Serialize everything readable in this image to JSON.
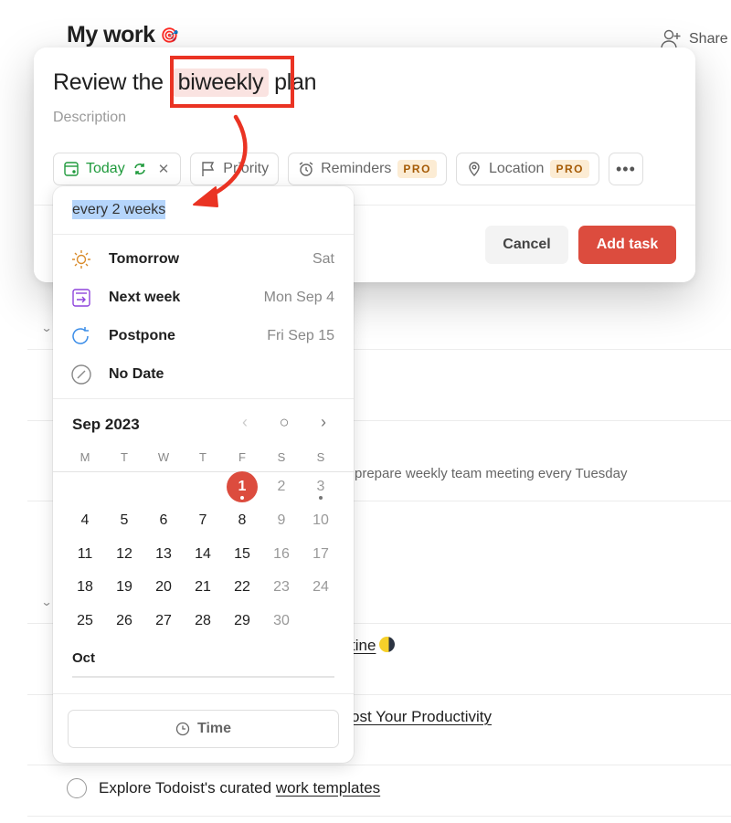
{
  "page": {
    "title": "My work",
    "title_emoji": "🎯",
    "share_label": "Share"
  },
  "background_tasks": {
    "visible_fragments": [
      {
        "text": "prepare weekly team meeting every Tuesday"
      },
      {
        "prefix": "",
        "link": "tine",
        "suffix": ""
      },
      {
        "prefix": "",
        "link": "ost Your Productivity",
        "suffix": ""
      }
    ],
    "last_task": {
      "prefix": "Explore Todoist's curated ",
      "link": "work templates"
    }
  },
  "task_editor": {
    "title_before": "Review the",
    "title_highlight": "biweekly",
    "title_after": "plan",
    "description_placeholder": "Description",
    "chips": {
      "date_label": "Today",
      "priority_label": "Priority",
      "reminders_label": "Reminders",
      "location_label": "Location",
      "pro_badge": "PRO",
      "more_label": "•••"
    },
    "cancel_label": "Cancel",
    "add_label": "Add task",
    "accent_color": "#dc4c3e",
    "date_color": "#1f9a3c"
  },
  "date_picker": {
    "input_value": "every 2 weeks",
    "quick_options": [
      {
        "label": "Tomorrow",
        "date": "Sat",
        "icon": "sun-icon"
      },
      {
        "label": "Next week",
        "date": "Mon Sep 4",
        "icon": "next-week-icon"
      },
      {
        "label": "Postpone",
        "date": "Fri Sep 15",
        "icon": "postpone-icon"
      },
      {
        "label": "No Date",
        "date": "",
        "icon": "no-date-icon"
      }
    ],
    "month_label": "Sep 2023",
    "weekdays": [
      "M",
      "T",
      "W",
      "T",
      "F",
      "S",
      "S"
    ],
    "weeks": [
      [
        "",
        "",
        "",
        "",
        "1",
        "2",
        "3"
      ],
      [
        "4",
        "5",
        "6",
        "7",
        "8",
        "9",
        "10"
      ],
      [
        "11",
        "12",
        "13",
        "14",
        "15",
        "16",
        "17"
      ],
      [
        "18",
        "19",
        "20",
        "21",
        "22",
        "23",
        "24"
      ],
      [
        "25",
        "26",
        "27",
        "28",
        "29",
        "30",
        ""
      ]
    ],
    "today": "1",
    "next_month_label": "Oct",
    "time_label": "Time"
  }
}
